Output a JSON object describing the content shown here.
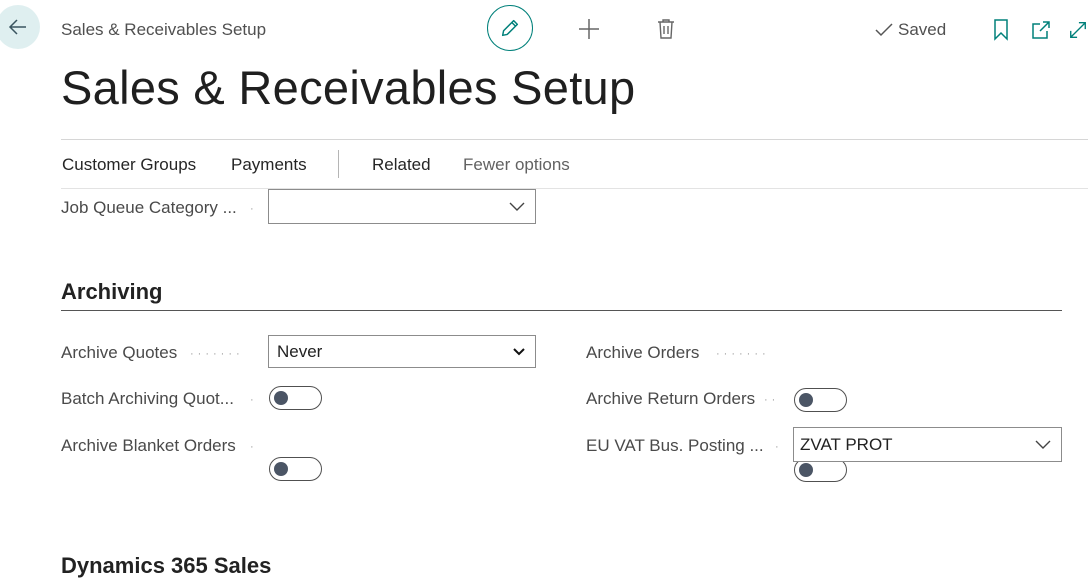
{
  "header": {
    "breadcrumb": "Sales & Receivables Setup",
    "saved_label": "Saved",
    "title": "Sales & Receivables Setup"
  },
  "actions": {
    "customer_groups": "Customer Groups",
    "payments": "Payments",
    "related": "Related",
    "fewer_options": "Fewer options"
  },
  "fields": {
    "job_queue_category": {
      "label": "Job Queue Category ...",
      "value": ""
    }
  },
  "archiving": {
    "title": "Archiving",
    "archive_quotes": {
      "label": "Archive Quotes",
      "value": "Never"
    },
    "batch_archiving_quotes": {
      "label": "Batch Archiving Quot...",
      "value": false
    },
    "archive_blanket_orders": {
      "label": "Archive Blanket Orders",
      "value": false
    },
    "archive_orders": {
      "label": "Archive Orders",
      "value": false
    },
    "archive_return_orders": {
      "label": "Archive Return Orders",
      "value": false
    },
    "eu_vat_bus_posting": {
      "label": "EU VAT Bus. Posting ...",
      "value": "ZVAT PROT"
    }
  },
  "next_section": {
    "title": "Dynamics 365 Sales"
  },
  "icons": {
    "back": "back-arrow-icon",
    "edit": "pencil-icon",
    "new": "plus-icon",
    "delete": "trash-icon",
    "saved": "checkmark-icon",
    "bookmark": "bookmark-icon",
    "open_new_window": "open-new-window-icon",
    "expand": "expand-icon"
  },
  "colors": {
    "accent": "#00807a",
    "back_button_bg": "#dfeff0"
  }
}
